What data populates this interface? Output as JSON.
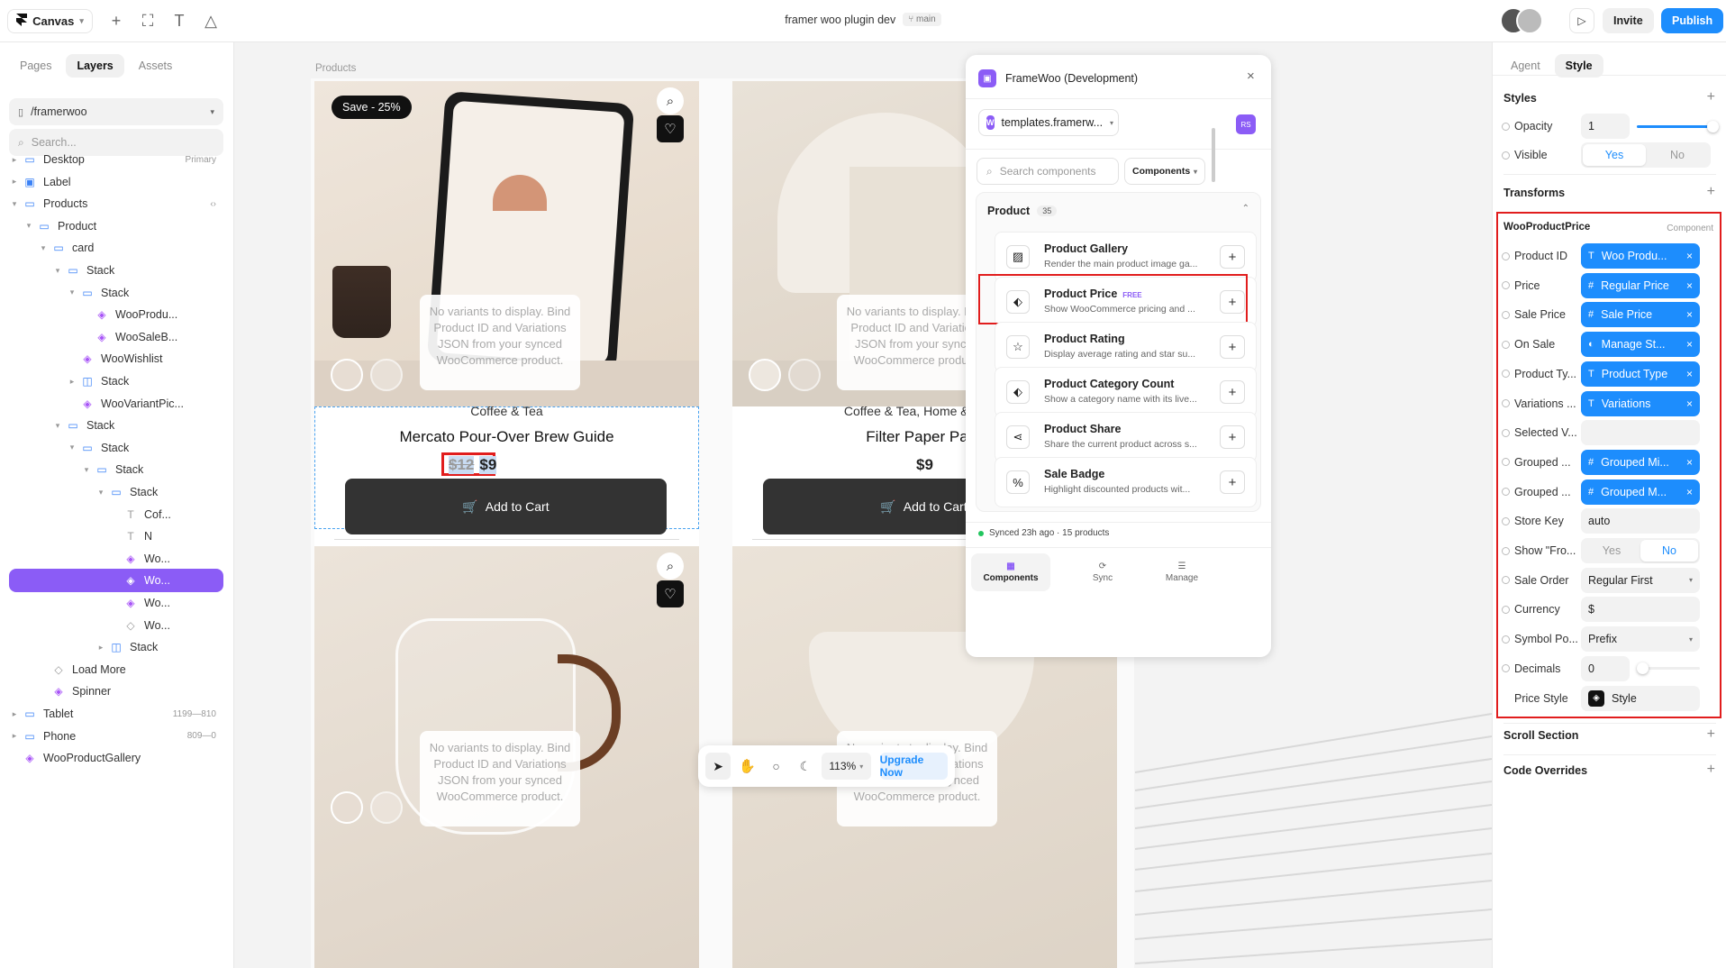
{
  "topbar": {
    "canvas_label": "Canvas",
    "doc_title": "framer woo plugin dev",
    "branch": "main",
    "invite": "Invite",
    "publish": "Publish"
  },
  "left": {
    "tabs": [
      "Pages",
      "Layers",
      "Assets"
    ],
    "page_path": "/framerwoo",
    "search_placeholder": "Search...",
    "layers": [
      {
        "label": "Desktop",
        "meta": "Primary"
      },
      {
        "label": "Label",
        "meta": ""
      },
      {
        "label": "Products",
        "meta": "‹›"
      },
      {
        "label": "Product",
        "meta": ""
      },
      {
        "label": "card",
        "meta": ""
      },
      {
        "label": "Stack",
        "meta": ""
      },
      {
        "label": "Stack",
        "meta": ""
      },
      {
        "label": "WooProdu...",
        "meta": ""
      },
      {
        "label": "WooSaleB...",
        "meta": ""
      },
      {
        "label": "WooWishlist",
        "meta": ""
      },
      {
        "label": "Stack",
        "meta": ""
      },
      {
        "label": "WooVariantPic...",
        "meta": ""
      },
      {
        "label": "Stack",
        "meta": ""
      },
      {
        "label": "Stack",
        "meta": ""
      },
      {
        "label": "Stack",
        "meta": ""
      },
      {
        "label": "Stack",
        "meta": ""
      },
      {
        "label": "Cof...",
        "meta": ""
      },
      {
        "label": "N",
        "meta": ""
      },
      {
        "label": "Wo...",
        "meta": ""
      },
      {
        "label": "Wo...",
        "meta": ""
      },
      {
        "label": "Wo...",
        "meta": ""
      },
      {
        "label": "Wo...",
        "meta": ""
      },
      {
        "label": "Stack",
        "meta": ""
      },
      {
        "label": "Load More",
        "meta": ""
      },
      {
        "label": "Spinner",
        "meta": ""
      },
      {
        "label": "Tablet",
        "meta": "1199—810"
      },
      {
        "label": "Phone",
        "meta": "809—0"
      },
      {
        "label": "WooProductGallery",
        "meta": ""
      }
    ]
  },
  "canvas": {
    "frame_label": "Products",
    "no_variants": "No variants to display. Bind Product ID and Variations JSON from your synced WooCommerce product.",
    "save_badge": "Save - 25%",
    "add_to_cart": "Add to Cart",
    "cards": [
      {
        "category": "Coffee & Tea",
        "name": "Mercato Pour-Over Brew Guide",
        "old_price": "$12",
        "price": "$9"
      },
      {
        "category": "Coffee & Tea, Home & Living",
        "name": "Filter Paper Pack",
        "old_price": "",
        "price": "$9"
      }
    ],
    "toolbar": {
      "zoom": "113%",
      "upgrade": "Upgrade Now"
    }
  },
  "plugin": {
    "title": "FrameWoo (Development)",
    "site": "templates.framerw...",
    "avatar": "RS",
    "search_placeholder": "Search components",
    "filter": "Components",
    "section": "Product",
    "count": "35",
    "items": [
      {
        "title": "Product Gallery",
        "desc": "Render the main product image ga...",
        "icon": "image-icon",
        "free": ""
      },
      {
        "title": "Product Price",
        "desc": "Show WooCommerce pricing and ...",
        "icon": "tag-icon",
        "free": "FREE"
      },
      {
        "title": "Product Rating",
        "desc": "Display average rating and star su...",
        "icon": "star-icon",
        "free": ""
      },
      {
        "title": "Product Category Count",
        "desc": "Show a category name with its live...",
        "icon": "tag-icon",
        "free": ""
      },
      {
        "title": "Product Share",
        "desc": "Share the current product across s...",
        "icon": "share-icon",
        "free": ""
      },
      {
        "title": "Sale Badge",
        "desc": "Highlight discounted products wit...",
        "icon": "percent-icon",
        "free": ""
      }
    ],
    "synced": "Synced 23h ago · 15 products",
    "nav": [
      "Components",
      "Sync",
      "Manage"
    ]
  },
  "right": {
    "tabs": [
      "Agent",
      "Style"
    ],
    "styles": "Styles",
    "opacity_label": "Opacity",
    "opacity_value": "1",
    "visible_label": "Visible",
    "yes": "Yes",
    "no": "No",
    "transforms": "Transforms",
    "component_name": "WooProductPrice",
    "component_tag": "Component",
    "props": [
      {
        "label": "Product ID",
        "value": "Woo Produ...",
        "kind": "chip",
        "icon": "T"
      },
      {
        "label": "Price",
        "value": "Regular Price",
        "kind": "chip",
        "icon": "#"
      },
      {
        "label": "Sale Price",
        "value": "Sale Price",
        "kind": "chip",
        "icon": "#"
      },
      {
        "label": "On Sale",
        "value": "Manage St...",
        "kind": "chip",
        "icon": "◐"
      },
      {
        "label": "Product Ty...",
        "value": "Product Type",
        "kind": "chip",
        "icon": "T"
      },
      {
        "label": "Variations ...",
        "value": "Variations",
        "kind": "chip",
        "icon": "T"
      },
      {
        "label": "Selected V...",
        "value": "",
        "kind": "input",
        "icon": ""
      },
      {
        "label": "Grouped ...",
        "value": "Grouped Mi...",
        "kind": "chip",
        "icon": "#"
      },
      {
        "label": "Grouped ...",
        "value": "Grouped M...",
        "kind": "chip",
        "icon": "#"
      },
      {
        "label": "Store Key",
        "value": "auto",
        "kind": "input",
        "icon": ""
      },
      {
        "label": "Show \"Fro...",
        "value": "",
        "kind": "seg",
        "icon": ""
      },
      {
        "label": "Sale Order",
        "value": "Regular First",
        "kind": "select",
        "icon": ""
      },
      {
        "label": "Currency",
        "value": "$",
        "kind": "input",
        "icon": ""
      },
      {
        "label": "Symbol Po...",
        "value": "Prefix",
        "kind": "select",
        "icon": ""
      },
      {
        "label": "Decimals",
        "value": "0",
        "kind": "slider",
        "icon": ""
      },
      {
        "label": "Price Style",
        "value": "Style",
        "kind": "style",
        "icon": ""
      }
    ],
    "scroll_section": "Scroll Section",
    "code_overrides": "Code Overrides"
  }
}
